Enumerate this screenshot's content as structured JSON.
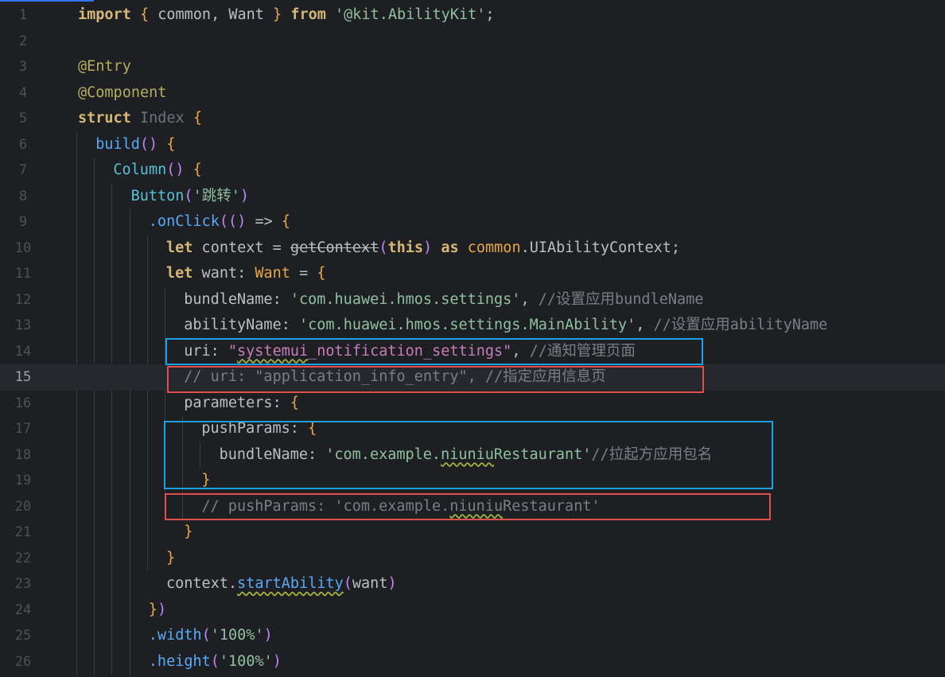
{
  "editor": {
    "current_line": 15,
    "lines": [
      {
        "n": "1",
        "indent": 0,
        "tokens": [
          [
            "kw",
            "import"
          ],
          [
            "plain",
            " "
          ],
          [
            "brace",
            "{"
          ],
          [
            "plain",
            " common, Want "
          ],
          [
            "brace",
            "}"
          ],
          [
            "plain",
            " "
          ],
          [
            "kw",
            "from"
          ],
          [
            "plain",
            " "
          ],
          [
            "str",
            "'@kit.AbilityKit'"
          ],
          [
            "plain",
            ";"
          ]
        ]
      },
      {
        "n": "2",
        "indent": 0,
        "tokens": []
      },
      {
        "n": "3",
        "indent": 0,
        "tokens": [
          [
            "dec",
            "@Entry"
          ]
        ]
      },
      {
        "n": "4",
        "indent": 0,
        "tokens": [
          [
            "dec",
            "@Component"
          ]
        ]
      },
      {
        "n": "5",
        "indent": 0,
        "tokens": [
          [
            "kw",
            "struct"
          ],
          [
            "plain",
            " "
          ],
          [
            "gray",
            "Index"
          ],
          [
            "plain",
            " "
          ],
          [
            "brace",
            "{"
          ]
        ]
      },
      {
        "n": "6",
        "indent": 1,
        "tokens": [
          [
            "fn",
            "build"
          ],
          [
            "paren",
            "()"
          ],
          [
            "plain",
            " "
          ],
          [
            "brace",
            "{"
          ]
        ]
      },
      {
        "n": "7",
        "indent": 2,
        "tokens": [
          [
            "cls",
            "Column"
          ],
          [
            "paren",
            "()"
          ],
          [
            "plain",
            " "
          ],
          [
            "brace",
            "{"
          ]
        ]
      },
      {
        "n": "8",
        "indent": 3,
        "tokens": [
          [
            "cls",
            "Button"
          ],
          [
            "paren",
            "("
          ],
          [
            "str",
            "'跳转'"
          ],
          [
            "paren",
            ")"
          ]
        ]
      },
      {
        "n": "9",
        "indent": 4,
        "tokens": [
          [
            "fn",
            ".onClick"
          ],
          [
            "paren",
            "(("
          ],
          [
            "paren",
            ")"
          ],
          [
            "plain",
            " => "
          ],
          [
            "brace",
            "{"
          ]
        ]
      },
      {
        "n": "10",
        "indent": 5,
        "tokens": [
          [
            "kw",
            "let"
          ],
          [
            "plain",
            " context = "
          ],
          [
            "dep",
            "getContext"
          ],
          [
            "paren",
            "("
          ],
          [
            "kw",
            "this"
          ],
          [
            "paren",
            ")"
          ],
          [
            "plain",
            " "
          ],
          [
            "kw",
            "as"
          ],
          [
            "plain",
            " "
          ],
          [
            "brace",
            "common"
          ],
          [
            "plain",
            ".UIAbilityContext;"
          ]
        ]
      },
      {
        "n": "11",
        "indent": 5,
        "tokens": [
          [
            "kw",
            "let"
          ],
          [
            "plain",
            " want: "
          ],
          [
            "brace",
            "Want"
          ],
          [
            "plain",
            " = "
          ],
          [
            "brace",
            "{"
          ]
        ]
      },
      {
        "n": "12",
        "indent": 6,
        "tokens": [
          [
            "prop",
            "bundleName"
          ],
          [
            "plain",
            ": "
          ],
          [
            "str",
            "'com.huawei.hmos.settings'"
          ],
          [
            "plain",
            ", "
          ],
          [
            "com",
            "//设置应用bundleName"
          ]
        ]
      },
      {
        "n": "13",
        "indent": 6,
        "tokens": [
          [
            "prop",
            "abilityName"
          ],
          [
            "plain",
            ": "
          ],
          [
            "str",
            "'com.huawei.hmos.settings.MainAbility'"
          ],
          [
            "plain",
            ", "
          ],
          [
            "com",
            "//设置应用abilityName"
          ]
        ]
      },
      {
        "n": "14",
        "indent": 6,
        "tokens": [
          [
            "prop",
            "uri"
          ],
          [
            "plain",
            ": "
          ],
          [
            "str2",
            "\""
          ],
          [
            "str2w",
            "systemui"
          ],
          [
            "str2",
            "_notification_settings\""
          ],
          [
            "plain",
            ", "
          ],
          [
            "com",
            "//通知管理页面"
          ]
        ]
      },
      {
        "n": "15",
        "indent": 6,
        "tokens": [
          [
            "com",
            "// uri: \"application_info_entry\", //指定应用信息页"
          ]
        ]
      },
      {
        "n": "16",
        "indent": 6,
        "tokens": [
          [
            "prop",
            "parameters"
          ],
          [
            "plain",
            ": "
          ],
          [
            "brace",
            "{"
          ]
        ]
      },
      {
        "n": "17",
        "indent": 7,
        "tokens": [
          [
            "prop",
            "pushParams"
          ],
          [
            "plain",
            ": "
          ],
          [
            "brace",
            "{"
          ]
        ]
      },
      {
        "n": "18",
        "indent": 8,
        "tokens": [
          [
            "prop",
            "bundleName"
          ],
          [
            "plain",
            ": "
          ],
          [
            "str",
            "'com.example."
          ],
          [
            "strw",
            "niuniu"
          ],
          [
            "str",
            "Restaurant'"
          ],
          [
            "com",
            "//拉起方应用包名"
          ]
        ]
      },
      {
        "n": "19",
        "indent": 7,
        "tokens": [
          [
            "brace",
            "}"
          ]
        ]
      },
      {
        "n": "20",
        "indent": 7,
        "tokens": [
          [
            "com",
            "// pushParams: 'com.example."
          ],
          [
            "comw",
            "niuniu"
          ],
          [
            "com",
            "Restaurant'"
          ]
        ]
      },
      {
        "n": "21",
        "indent": 6,
        "tokens": [
          [
            "brace",
            "}"
          ]
        ]
      },
      {
        "n": "22",
        "indent": 5,
        "tokens": [
          [
            "brace",
            "}"
          ]
        ]
      },
      {
        "n": "23",
        "indent": 5,
        "tokens": [
          [
            "plain",
            "context."
          ],
          [
            "fnw",
            "startAbility"
          ],
          [
            "paren",
            "("
          ],
          [
            "plain",
            "want"
          ],
          [
            "paren",
            ")"
          ]
        ]
      },
      {
        "n": "24",
        "indent": 4,
        "tokens": [
          [
            "brace",
            "}"
          ],
          [
            "paren",
            ")"
          ]
        ]
      },
      {
        "n": "25",
        "indent": 4,
        "tokens": [
          [
            "fn",
            ".width"
          ],
          [
            "paren",
            "("
          ],
          [
            "str",
            "'100%'"
          ],
          [
            "paren",
            ")"
          ]
        ]
      },
      {
        "n": "26",
        "indent": 4,
        "tokens": [
          [
            "fn",
            ".height"
          ],
          [
            "paren",
            "("
          ],
          [
            "str",
            "'100%'"
          ],
          [
            "paren",
            ")"
          ]
        ]
      }
    ]
  },
  "highlights": [
    {
      "color": "blue",
      "label": "uri-box"
    },
    {
      "color": "red",
      "label": "commented-uri-box"
    },
    {
      "color": "blue",
      "label": "push-params-box"
    },
    {
      "color": "red",
      "label": "commented-push-params-box"
    }
  ]
}
